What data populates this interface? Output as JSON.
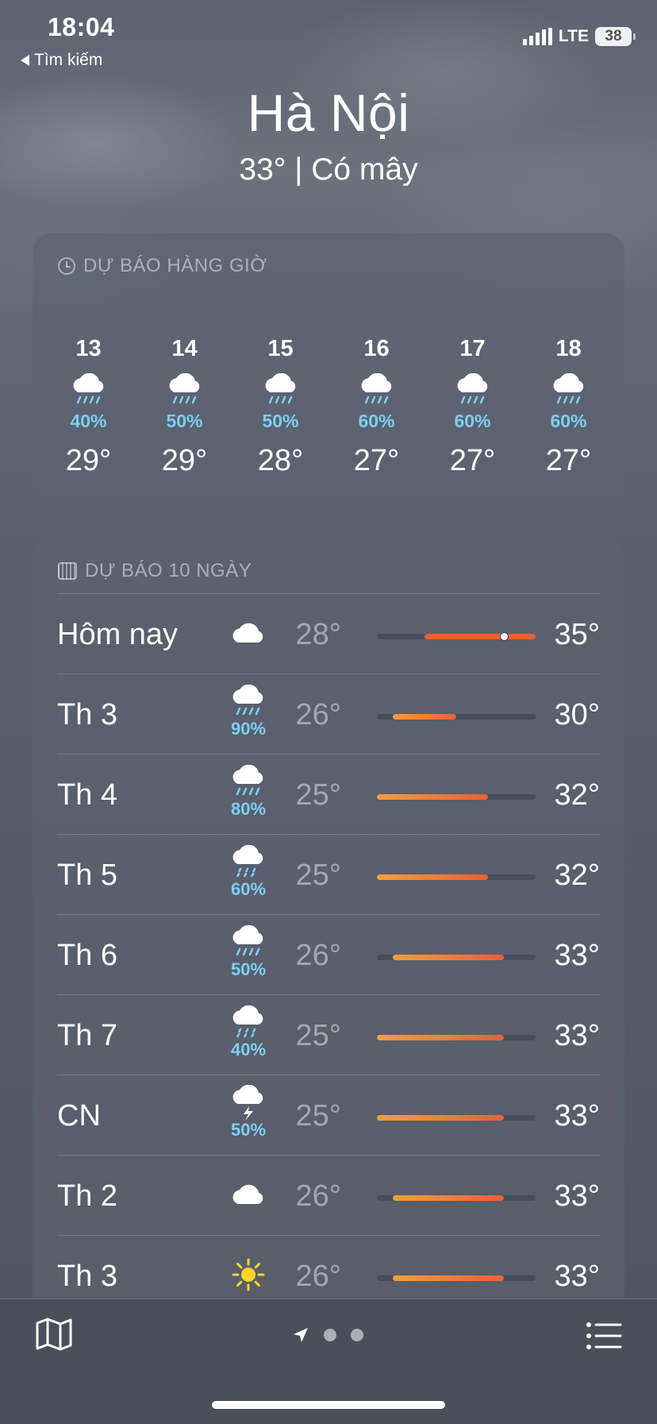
{
  "status_bar": {
    "time": "18:04",
    "back_label": "Tìm kiếm",
    "network": "LTE",
    "battery": "38"
  },
  "header": {
    "city": "Hà Nội",
    "summary": "33°  |  Có mây"
  },
  "hourly": {
    "title": "DỰ BÁO HÀNG GIỜ",
    "items": [
      {
        "hour": "13",
        "icon": "rain-icon",
        "pop": "40%",
        "temp": "29°"
      },
      {
        "hour": "14",
        "icon": "rain-icon",
        "pop": "50%",
        "temp": "29°"
      },
      {
        "hour": "15",
        "icon": "rain-icon",
        "pop": "50%",
        "temp": "28°"
      },
      {
        "hour": "16",
        "icon": "rain-icon",
        "pop": "60%",
        "temp": "27°"
      },
      {
        "hour": "17",
        "icon": "rain-icon",
        "pop": "60%",
        "temp": "27°"
      },
      {
        "hour": "18",
        "icon": "rain-icon",
        "pop": "60%",
        "temp": "27°"
      }
    ]
  },
  "daily": {
    "title": "DỰ BÁO 10 NGÀY",
    "range_min": 25,
    "range_max": 35,
    "current_temp": 33,
    "rows": [
      {
        "day": "Hôm nay",
        "icon": "cloud-icon",
        "pop": "",
        "low": "28°",
        "high": "35°",
        "low_val": 28,
        "high_val": 35
      },
      {
        "day": "Th 3",
        "icon": "rain-icon",
        "pop": "90%",
        "low": "26°",
        "high": "30°",
        "low_val": 26,
        "high_val": 30
      },
      {
        "day": "Th 4",
        "icon": "rain-icon",
        "pop": "80%",
        "low": "25°",
        "high": "32°",
        "low_val": 25,
        "high_val": 32
      },
      {
        "day": "Th 5",
        "icon": "drizzle-icon",
        "pop": "60%",
        "low": "25°",
        "high": "32°",
        "low_val": 25,
        "high_val": 32
      },
      {
        "day": "Th 6",
        "icon": "rain-icon",
        "pop": "50%",
        "low": "26°",
        "high": "33°",
        "low_val": 26,
        "high_val": 33
      },
      {
        "day": "Th 7",
        "icon": "drizzle-icon",
        "pop": "40%",
        "low": "25°",
        "high": "33°",
        "low_val": 25,
        "high_val": 33
      },
      {
        "day": "CN",
        "icon": "thunderstorm-icon",
        "pop": "50%",
        "low": "25°",
        "high": "33°",
        "low_val": 25,
        "high_val": 33
      },
      {
        "day": "Th 2",
        "icon": "cloud-icon",
        "pop": "",
        "low": "26°",
        "high": "33°",
        "low_val": 26,
        "high_val": 33
      },
      {
        "day": "Th 3",
        "icon": "sun-icon",
        "pop": "",
        "low": "26°",
        "high": "33°",
        "low_val": 26,
        "high_val": 33
      }
    ]
  },
  "toolbar": {
    "left_icon": "map-icon",
    "center_icon": "location-arrow-icon",
    "right_icon": "list-icon"
  },
  "colors": {
    "precip": "#7fcdf3",
    "bar_warm": "#f0a040",
    "bar_hot": "#e8603a",
    "sun": "#ffd426"
  }
}
